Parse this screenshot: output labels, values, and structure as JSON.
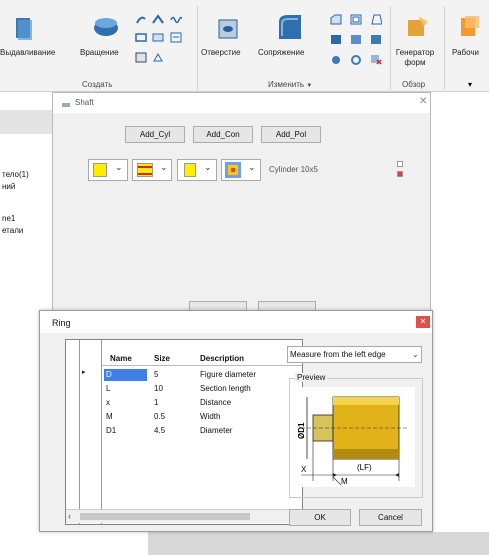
{
  "ribbon": {
    "buttons": [
      {
        "label": "Выдавливание"
      },
      {
        "label": "Вращение"
      },
      {
        "label": "Отверстие"
      },
      {
        "label": "Сопряжение"
      },
      {
        "label": "Генератор форм"
      },
      {
        "label": "Рабочи"
      }
    ],
    "groups": {
      "create": "Создать",
      "modify": "Изменить",
      "modify_arrow": "▼",
      "review": "Обзор"
    }
  },
  "left_panel": {
    "lines": [
      "тело(1)",
      "ний",
      "ne1",
      "етали"
    ]
  },
  "shaft": {
    "title": "Shaft",
    "close": "✕",
    "tabs": [
      "Add_Cyl",
      "Add_Con",
      "Add_Pol"
    ],
    "color_dropdowns": [
      {
        "swatch": "#ffee00",
        "arrow": "⌄"
      },
      {
        "swatch": "#ffee00",
        "arrow": "⌄"
      },
      {
        "swatch": "#ffee00",
        "arrow": "⌄"
      },
      {
        "swatch": "#ffcc00",
        "arrow": "⌄"
      }
    ],
    "element_label": "Cylinder 10x5"
  },
  "ring": {
    "title": "Ring",
    "close": "✕",
    "columns": [
      "Name",
      "Size",
      "Description"
    ],
    "rows": [
      {
        "name": "D",
        "size": "5",
        "desc": "Figure diameter",
        "selected": true
      },
      {
        "name": "L",
        "size": "10",
        "desc": "Section length",
        "selected": false
      },
      {
        "name": "x",
        "size": "1",
        "desc": "Distance",
        "selected": false
      },
      {
        "name": "M",
        "size": "0.5",
        "desc": "Width",
        "selected": false
      },
      {
        "name": "D1",
        "size": "4.5",
        "desc": "Diameter",
        "selected": false
      }
    ],
    "row_marker": "▸",
    "measure_select": "Measure from the left edge",
    "preview_label": "Preview",
    "preview_dims": {
      "d1": "ØD1",
      "x": "X",
      "lf": "(LF)",
      "m": "M"
    },
    "ok_label": "OK",
    "cancel_label": "Cancel",
    "scroll_left": "‹",
    "scroll_right": "›"
  }
}
